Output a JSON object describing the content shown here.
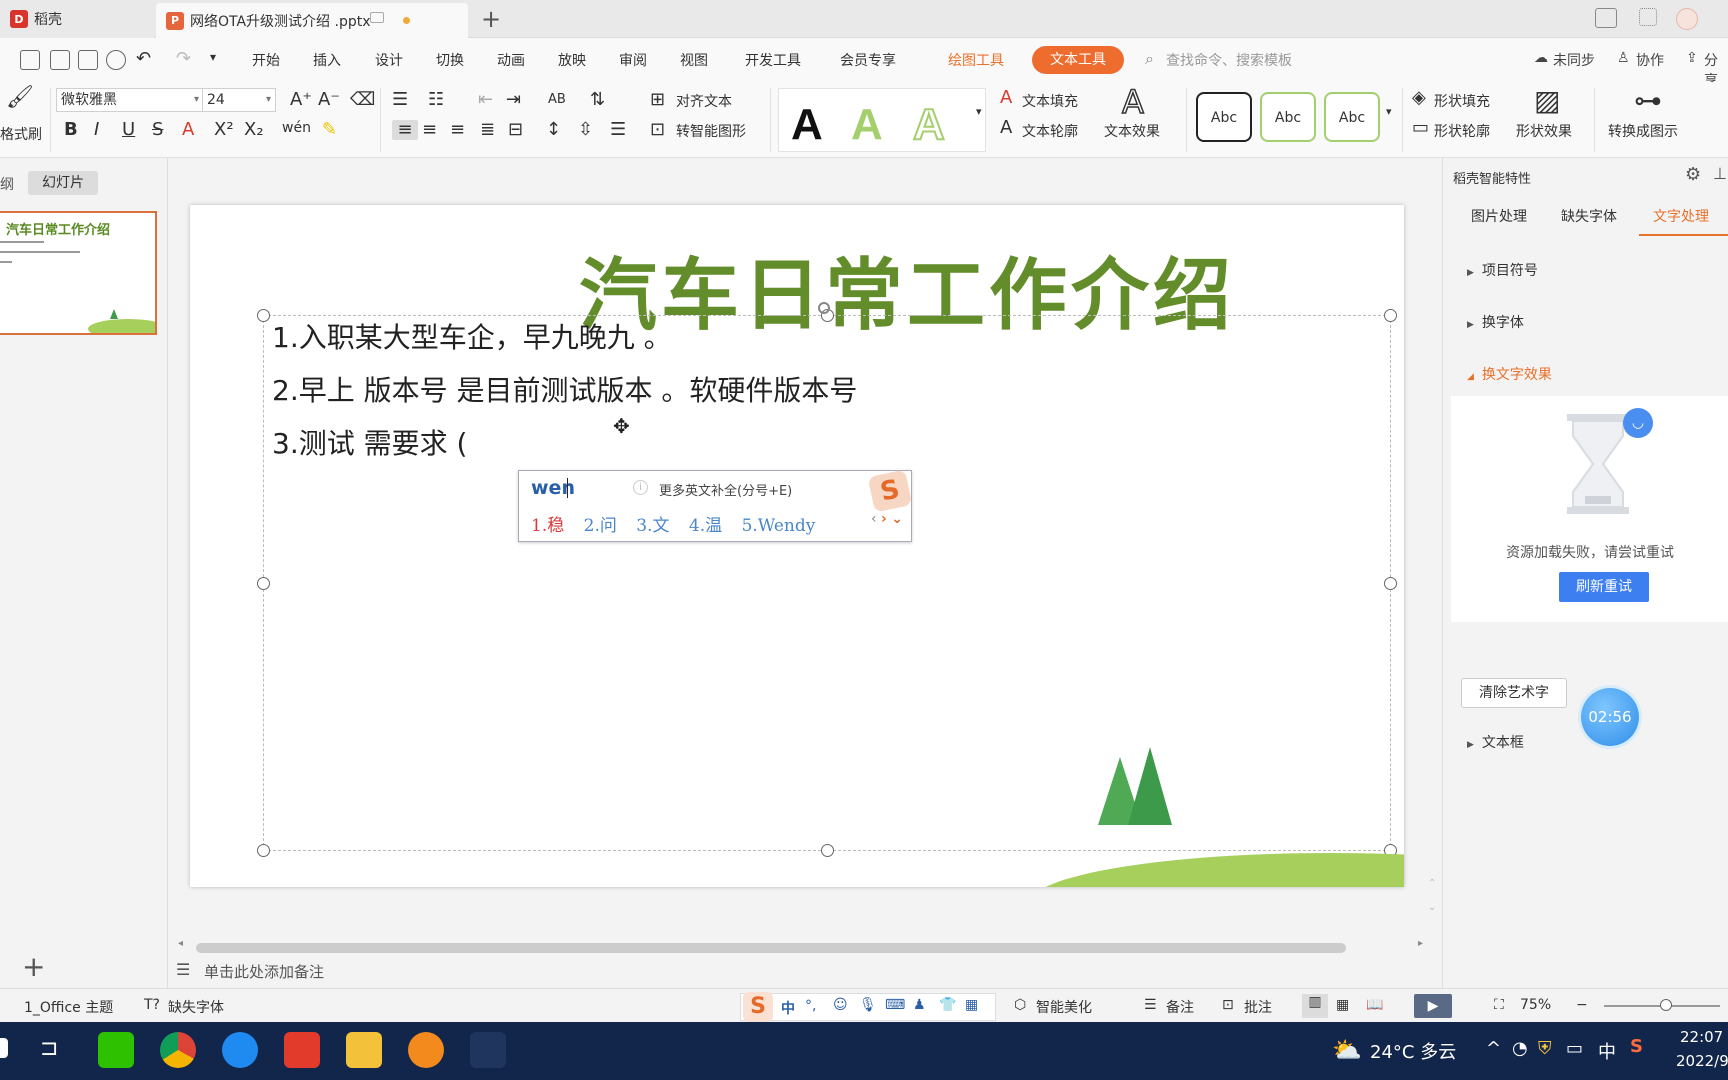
{
  "window": {
    "home_tab": "稻壳",
    "doc_tab": "网络OTA升级测试介绍 .pptx"
  },
  "menu": {
    "tabs": [
      "开始",
      "插入",
      "设计",
      "切换",
      "动画",
      "放映",
      "审阅",
      "视图",
      "开发工具",
      "会员专享"
    ],
    "drawing_tool": "绘图工具",
    "text_tool": "文本工具",
    "search_placeholder": "查找命令、搜索模板",
    "sync": "未同步",
    "collab": "协作",
    "share": "分享"
  },
  "ribbon": {
    "format_painter": "格式刷",
    "font_name": "微软雅黑",
    "font_size": "24",
    "align_text": "对齐文本",
    "smart_shape": "转智能图形",
    "text_fill": "文本填充",
    "text_outline": "文本轮廓",
    "text_effect": "文本效果",
    "shape_styles": [
      "Abc",
      "Abc",
      "Abc"
    ],
    "shape_fill": "形状填充",
    "shape_outline": "形状轮廓",
    "shape_effect": "形状效果",
    "convert_to_diagram": "转换成图示",
    "wordart_letter": "A"
  },
  "left_panel": {
    "outline_tab": "纲",
    "slides_tab": "幻灯片",
    "thumb_title": "汽车日常工作介绍"
  },
  "slide": {
    "title": "汽车日常工作介绍",
    "bullets": [
      "1.入职某大型车企，早九晚九 。",
      "2.早上  版本号 是目前测试版本 。软硬件版本号",
      "3.测试 需要求  ("
    ]
  },
  "ime": {
    "input": "wen",
    "hint": "更多英文补全(分号+E)",
    "candidates": [
      "1.稳",
      "2.问",
      "3.文",
      "4.温",
      "5.Wendy"
    ]
  },
  "notes_placeholder": "单击此处添加备注",
  "right_pane": {
    "header": "稻壳智能特性",
    "tabs": [
      "图片处理",
      "缺失字体",
      "文字处理"
    ],
    "sections": [
      "项目符号",
      "换字体",
      "换文字效果"
    ],
    "error_text": "资源加载失败，请尝试重试",
    "retry_button": "刷新重试",
    "clear_wordart": "清除艺术字",
    "textbox_section": "文本框",
    "timer": "02:56"
  },
  "status": {
    "theme": "1_Office 主题",
    "missing_font": "缺失字体",
    "smart_beautify": "智能美化",
    "notes": "备注",
    "comments": "批注",
    "zoom": "75%"
  },
  "taskbar": {
    "weather": "24°C 多云",
    "ime_lang": "中",
    "time": "22:07",
    "date": "2022/9"
  },
  "colors": {
    "accent_orange": "#ef6c2f",
    "title_green": "#628d2a",
    "taskbar": "#12254a"
  }
}
